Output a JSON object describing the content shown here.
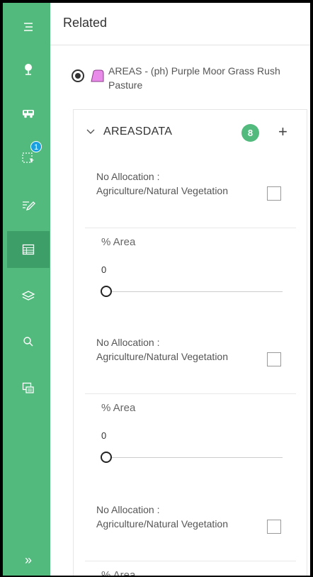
{
  "sidebar": {
    "badge_count": "1",
    "expand_label": "»",
    "items": [
      {
        "name": "menu-icon"
      },
      {
        "name": "location-pin-icon"
      },
      {
        "name": "vehicle-icon"
      },
      {
        "name": "select-icon"
      },
      {
        "name": "edit-icon"
      },
      {
        "name": "table-icon",
        "active": true
      },
      {
        "name": "layers-icon"
      },
      {
        "name": "search-icon"
      },
      {
        "name": "chat-icon"
      }
    ],
    "color": "#52ba7d",
    "active_color": "#3e9e67"
  },
  "panel": {
    "title": "Related",
    "feature": {
      "name": "AREAS - (ph) Purple Moor Grass Rush Pasture",
      "swatch_color": "#e98be9",
      "selected": true
    },
    "table": {
      "name": "AREASDATA",
      "count": "8",
      "add_label": "+",
      "records": [
        {
          "label": "No Allocation : Agriculture/Natural Vegetation",
          "checked": false,
          "field_label": "% Area",
          "field_value": "0"
        },
        {
          "label": "No Allocation : Agriculture/Natural Vegetation",
          "checked": false,
          "field_label": "% Area",
          "field_value": "0"
        },
        {
          "label": "No Allocation : Agriculture/Natural Vegetation",
          "checked": false,
          "field_label": "% Area",
          "field_value": ""
        }
      ]
    }
  }
}
